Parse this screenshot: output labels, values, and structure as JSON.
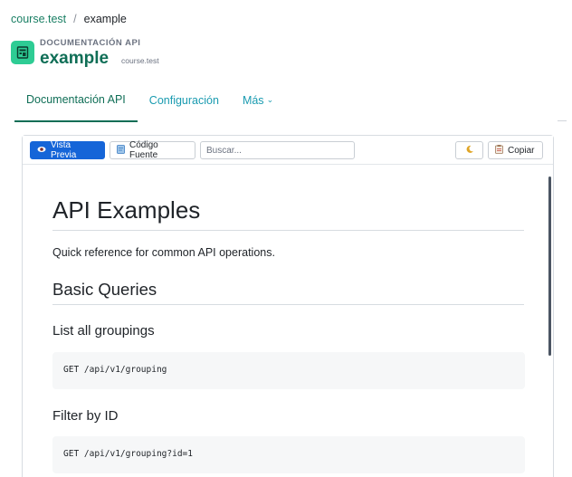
{
  "breadcrumb": {
    "parent": "course.test",
    "separator": "/",
    "current": "example"
  },
  "header": {
    "subtitle": "DOCUMENTACIÓN API",
    "title": "example",
    "meta": "course.test"
  },
  "tabs": [
    {
      "label": "Documentación API",
      "active": true
    },
    {
      "label": "Configuración",
      "active": false
    },
    {
      "label": "Más",
      "active": false
    }
  ],
  "toolbar": {
    "preview_label": "Vista Previa",
    "source_label": "Código Fuente",
    "search_placeholder": "Buscar...",
    "copy_label": "Copiar"
  },
  "doc": {
    "h1": "API Examples",
    "intro": "Quick reference for common API operations.",
    "h2": "Basic Queries",
    "sections": [
      {
        "heading": "List all groupings",
        "code": "GET /api/v1/grouping"
      },
      {
        "heading": "Filter by ID",
        "code": "GET /api/v1/grouping?id=1"
      }
    ]
  },
  "colors": {
    "accent": "#0f6e56",
    "link": "#1a9bb0",
    "primary_button": "#1565d8",
    "app_icon": "#2ecc94"
  },
  "icons": {
    "app": "api-doc-icon",
    "preview": "eye-icon",
    "source": "code-file-icon",
    "theme": "moon-icon",
    "copy": "clipboard-icon"
  }
}
